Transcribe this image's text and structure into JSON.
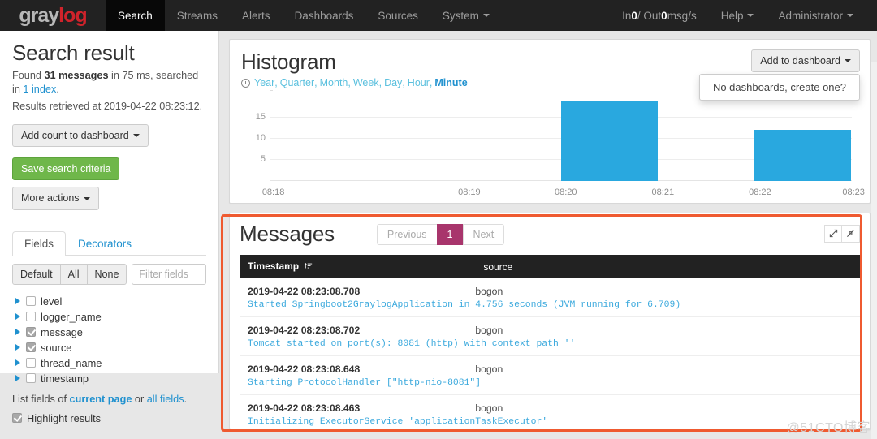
{
  "navbar": {
    "brand_gray": "gray",
    "brand_log": "log",
    "items": [
      {
        "label": "Search",
        "active": true
      },
      {
        "label": "Streams",
        "active": false
      },
      {
        "label": "Alerts",
        "active": false
      },
      {
        "label": "Dashboards",
        "active": false
      },
      {
        "label": "Sources",
        "active": false
      },
      {
        "label": "System",
        "active": false,
        "caret": true
      }
    ],
    "throughput_prefix": "In ",
    "throughput_in": "0",
    "throughput_mid": " / Out ",
    "throughput_out": "0",
    "throughput_suffix": " msg/s",
    "help_label": "Help",
    "user_label": "Administrator"
  },
  "sidebar": {
    "title": "Search result",
    "found_prefix": "Found ",
    "found_count": "31 messages",
    "found_mid": " in 75 ms, searched in ",
    "found_index": "1 index",
    "found_suffix": ".",
    "retrieved": "Results retrieved at 2019-04-22 08:23:12.",
    "add_count_label": "Add count to dashboard",
    "save_label": "Save search criteria",
    "more_actions_label": "More actions",
    "tabs": [
      {
        "label": "Fields",
        "active": true
      },
      {
        "label": "Decorators",
        "active": false
      }
    ],
    "segments": [
      "Default",
      "All",
      "None"
    ],
    "filter_placeholder": "Filter fields",
    "filter_value": "",
    "fields": [
      {
        "label": "level",
        "checked": false
      },
      {
        "label": "logger_name",
        "checked": false
      },
      {
        "label": "message",
        "checked": true
      },
      {
        "label": "source",
        "checked": true
      },
      {
        "label": "thread_name",
        "checked": false
      },
      {
        "label": "timestamp",
        "checked": false
      }
    ],
    "listfields_prefix": "List fields of ",
    "listfields_current": "current page",
    "listfields_mid": " or ",
    "listfields_all": "all fields",
    "listfields_suffix": ".",
    "highlight_label": "Highlight results",
    "highlight_checked": true
  },
  "histogram": {
    "title": "Histogram",
    "resolutions": [
      "Year",
      "Quarter",
      "Month",
      "Week",
      "Day",
      "Hour",
      "Minute"
    ],
    "active_resolution": "Minute",
    "add_to_dashboard_label": "Add to dashboard",
    "dropdown_text": "No dashboards, create one?"
  },
  "chart_data": {
    "type": "bar",
    "title": "Histogram",
    "xlabel": "",
    "ylabel": "",
    "categories": [
      "08:18",
      "08:19",
      "08:20",
      "08:21",
      "08:22",
      "08:23"
    ],
    "values": [
      0,
      0,
      0,
      19,
      0,
      12
    ],
    "ylim": [
      0,
      19.5
    ],
    "yticks": [
      5,
      10,
      15
    ],
    "grid": true,
    "legend": false,
    "bar_color": "#29a8df"
  },
  "messages": {
    "title": "Messages",
    "pager": {
      "previous": "Previous",
      "pages": [
        "1"
      ],
      "current_page": "1",
      "next": "Next"
    },
    "tools": [
      "expand-icon",
      "collapse-icon"
    ],
    "columns": [
      "Timestamp",
      "source"
    ],
    "rows": [
      {
        "timestamp": "2019-04-22 08:23:08.708",
        "source": "bogon",
        "body": "Started Springboot2GraylogApplication in 4.756 seconds (JVM running for 6.709)"
      },
      {
        "timestamp": "2019-04-22 08:23:08.702",
        "source": "bogon",
        "body": "Tomcat started on port(s): 8081 (http) with context path ''"
      },
      {
        "timestamp": "2019-04-22 08:23:08.648",
        "source": "bogon",
        "body": "Starting ProtocolHandler [\"http-nio-8081\"]"
      },
      {
        "timestamp": "2019-04-22 08:23:08.463",
        "source": "bogon",
        "body": "Initializing ExecutorService 'applicationTaskExecutor'"
      }
    ]
  },
  "annotation": {
    "highlight_color": "#ef5a30",
    "watermark": "@51CTO博客"
  }
}
